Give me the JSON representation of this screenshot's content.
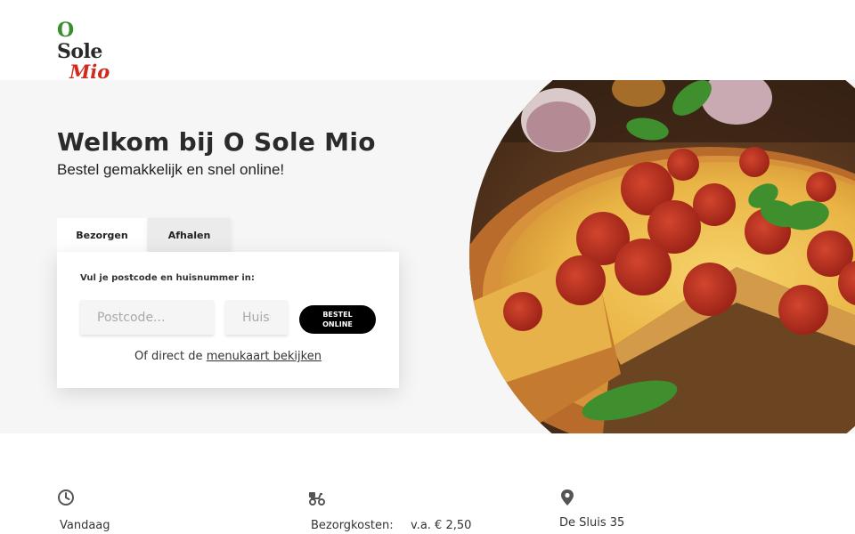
{
  "brand": {
    "logo_line1_o": "O",
    "logo_line1_rest": "Sole",
    "logo_line2": "Mio"
  },
  "hero": {
    "title": "Welkom bij O Sole Mio",
    "subtitle": "Bestel gemakkelijk en snel online!"
  },
  "tabs": {
    "deliver": "Bezorgen",
    "pickup": "Afhalen"
  },
  "order_form": {
    "label": "Vul je postcode en huisnummer in:",
    "postcode_placeholder": "Postcode...",
    "housenumber_placeholder": "Huisnr.",
    "button_line1": "BESTEL",
    "button_line2": "ONLINE",
    "direct_prefix": "Of direct de",
    "menu_link": "menukaart bekijken"
  },
  "info": {
    "hours": {
      "icon": "clock-icon",
      "text": "Vandaag"
    },
    "delivery": {
      "icon": "scooter-icon",
      "label": "Bezorgkosten:",
      "value": "v.a. € 2,50"
    },
    "address": {
      "icon": "map-pin-icon",
      "text": "De Sluis 35"
    }
  },
  "colors": {
    "logo_green": "#3a8f2c",
    "logo_red": "#d12a1d",
    "button": "#000000",
    "hero_bg": "#f6f6f7"
  }
}
